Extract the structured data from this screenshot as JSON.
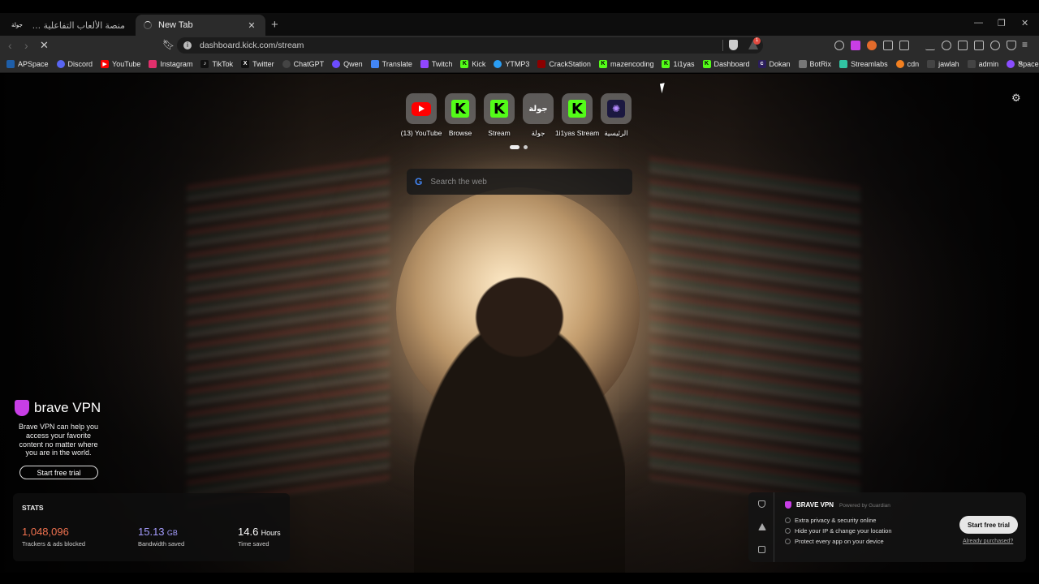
{
  "tabs": [
    {
      "title": "منصة الألعاب التفاعلية - Jawlah | جولة",
      "favicon": "جولة"
    },
    {
      "title": "New Tab",
      "loading": true
    }
  ],
  "address": {
    "url": "dashboard.kick.com/stream",
    "rewards_badge": "1"
  },
  "bookmarks": [
    {
      "label": "APSpace",
      "icon": "apspace-icon",
      "color": "#1e5ea8"
    },
    {
      "label": "Discord",
      "icon": "discord-icon",
      "color": "#5865f2"
    },
    {
      "label": "YouTube",
      "icon": "youtube-icon",
      "color": "#ff0000"
    },
    {
      "label": "Instagram",
      "icon": "instagram-icon",
      "color": "#e1306c"
    },
    {
      "label": "TikTok",
      "icon": "tiktok-icon",
      "color": "#111111"
    },
    {
      "label": "Twitter",
      "icon": "x-icon",
      "color": "#111111"
    },
    {
      "label": "ChatGPT",
      "icon": "chatgpt-icon",
      "color": "#444444"
    },
    {
      "label": "Qwen",
      "icon": "qwen-icon",
      "color": "#6c4cff"
    },
    {
      "label": "Translate",
      "icon": "translate-icon",
      "color": "#4285f4"
    },
    {
      "label": "Twitch",
      "icon": "twitch-icon",
      "color": "#9146ff"
    },
    {
      "label": "Kick",
      "icon": "kick-icon",
      "color": "#53fc18"
    },
    {
      "label": "YTMP3",
      "icon": "ytmp3-icon",
      "color": "#2a9df4"
    },
    {
      "label": "CrackStation",
      "icon": "crackstation-icon",
      "color": "#8b0000"
    },
    {
      "label": "mazencoding",
      "icon": "kick-icon",
      "color": "#53fc18"
    },
    {
      "label": "1i1yas",
      "icon": "kick-icon",
      "color": "#53fc18"
    },
    {
      "label": "Dashboard",
      "icon": "kick-icon",
      "color": "#53fc18"
    },
    {
      "label": "Dokan",
      "icon": "dokan-icon",
      "color": "#2b1d5c"
    },
    {
      "label": "BotRix",
      "icon": "botrix-icon",
      "color": "#777777"
    },
    {
      "label": "Streamlabs",
      "icon": "streamlabs-icon",
      "color": "#31c3a2"
    },
    {
      "label": "cdn",
      "icon": "cdn-icon",
      "color": "#f38020"
    },
    {
      "label": "jawlah",
      "icon": "jawlah-icon",
      "color": "#444444"
    },
    {
      "label": "admin",
      "icon": "jawlah-icon",
      "color": "#444444"
    },
    {
      "label": "Spacemail",
      "icon": "spacemail-icon",
      "color": "#8a4dff"
    }
  ],
  "top_sites": [
    {
      "label": "(13) YouTube",
      "icon": "youtube-icon"
    },
    {
      "label": "Browse",
      "icon": "kick-icon"
    },
    {
      "label": "Stream",
      "icon": "kick-icon"
    },
    {
      "label": "جولة",
      "icon": "jawlah-icon",
      "tile_text": "جولة"
    },
    {
      "label": "1i1yas Stream",
      "icon": "kick-icon"
    },
    {
      "label": "الرئيسية",
      "icon": "home-site-icon"
    }
  ],
  "search": {
    "placeholder": "Search the web",
    "engine_icon": "google-icon"
  },
  "vpn_promo": {
    "brand": "brave VPN",
    "description": "Brave VPN can help you access your favorite content no matter where you are in the world.",
    "button": "Start free trial"
  },
  "stats": {
    "heading": "STATS",
    "trackers": {
      "value": "1,048,096",
      "label": "Trackers & ads blocked",
      "color": "#f0724f"
    },
    "bandwidth": {
      "value": "15.13",
      "unit": "GB",
      "label": "Bandwidth saved",
      "color": "#a59dff"
    },
    "time": {
      "value": "14.6",
      "unit": "Hours",
      "label": "Time saved",
      "color": "#ffffff"
    }
  },
  "vpn_card": {
    "title": "BRAVE VPN",
    "powered": "Powered by  Guardian",
    "features": [
      "Extra privacy & security online",
      "Hide your IP & change your location",
      "Protect every app on your device"
    ],
    "button": "Start free trial",
    "link": "Already purchased?"
  }
}
